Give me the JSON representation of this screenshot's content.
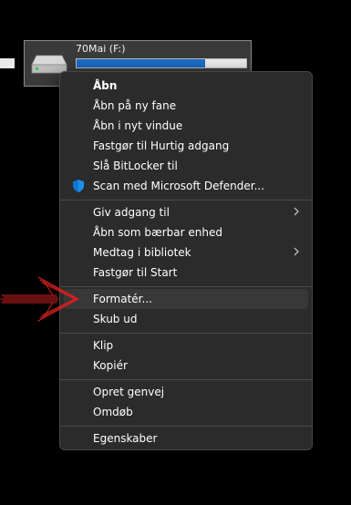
{
  "drive": {
    "label": "70Mai (F:)",
    "usage_fraction": 0.76,
    "bar_color": "#1b6ac4",
    "icon": "drive-icon"
  },
  "menu": {
    "items": [
      {
        "label": "Åbn",
        "bold": true
      },
      {
        "label": "Åbn på ny fane"
      },
      {
        "label": "Åbn i nyt vindue"
      },
      {
        "label": "Fastgør til Hurtig adgang"
      },
      {
        "label": "Slå BitLocker til"
      },
      {
        "label": "Scan med Microsoft Defender...",
        "icon": "defender-shield-icon"
      },
      {
        "label": "Giv adgang til",
        "submenu": true
      },
      {
        "label": "Åbn som bærbar enhed"
      },
      {
        "label": "Medtag i bibliotek",
        "submenu": true
      },
      {
        "label": "Fastgør til Start"
      },
      {
        "label": "Formatér...",
        "highlighted": true
      },
      {
        "label": "Skub ud"
      },
      {
        "label": "Klip"
      },
      {
        "label": "Kopiér"
      },
      {
        "label": "Opret genvej"
      },
      {
        "label": "Omdøb"
      },
      {
        "label": "Egenskaber"
      }
    ]
  },
  "annotation": {
    "icon": "red-arrow-icon",
    "color": "#d42020"
  },
  "colors": {
    "menu_bg": "#2b2b2b",
    "menu_border": "#464646",
    "hover_bg": "#383838",
    "text": "#ffffff",
    "defender_blue": "#0a78d4"
  }
}
